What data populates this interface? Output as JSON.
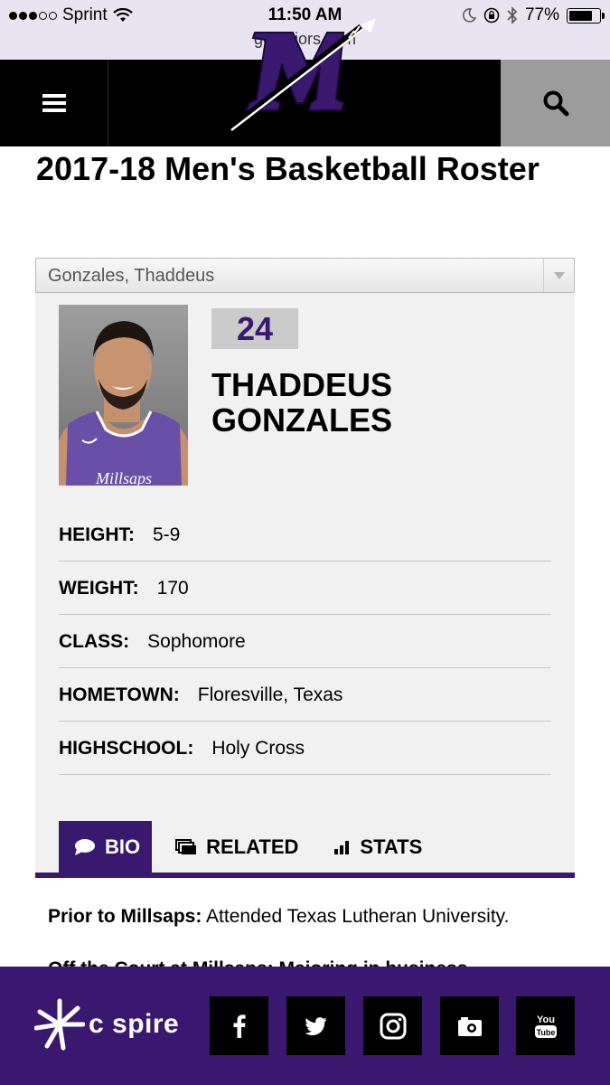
{
  "status_bar": {
    "carrier": "Sprint",
    "time": "11:50 AM",
    "battery": "77%",
    "battery_level": 0.77,
    "url": "gomajors.com",
    "signal_bars_filled": 3,
    "signal_bars_total": 5
  },
  "nav": {
    "menu_icon": "hamburger-menu-icon",
    "search_icon": "search-icon",
    "logo": "M"
  },
  "page": {
    "title": "2017-18 Men's Basketball Roster"
  },
  "select": {
    "value": "Gonzales, Thaddeus"
  },
  "player": {
    "number": "24",
    "name": "THADDEUS GONZALES",
    "jersey_text": "Millsaps",
    "attributes": [
      {
        "label": "HEIGHT:",
        "value": "5-9"
      },
      {
        "label": "WEIGHT:",
        "value": "170"
      },
      {
        "label": "CLASS:",
        "value": "Sophomore"
      },
      {
        "label": "HOMETOWN:",
        "value": "Floresville, Texas"
      },
      {
        "label": "HIGHSCHOOL:",
        "value": "Holy Cross"
      }
    ]
  },
  "tabs": [
    {
      "label": "BIO",
      "icon": "speech-bubble-icon",
      "active": true
    },
    {
      "label": "RELATED",
      "icon": "layers-icon",
      "active": false
    },
    {
      "label": "STATS",
      "icon": "bar-chart-icon",
      "active": false
    }
  ],
  "bio": {
    "label": "Prior to Millsaps:",
    "text": "Attended Texas Lutheran University.",
    "next_line_partial": "Off the Court at Millsaps: Majoring in business"
  },
  "footer": {
    "sponsor": "c spire",
    "social": [
      "facebook-icon",
      "twitter-icon",
      "instagram-icon",
      "photo-icon",
      "youtube-icon"
    ]
  },
  "colors": {
    "brand_purple": "#3b1870",
    "nav_black": "#000000",
    "search_gray": "#9c9c9c",
    "panel_gray": "#f1f1f1",
    "status_bg": "#e9e4f1"
  }
}
